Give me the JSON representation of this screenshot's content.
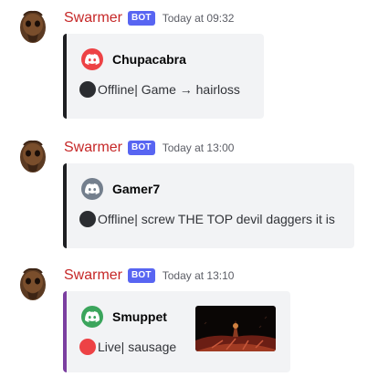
{
  "messages": [
    {
      "username": "Swarmer",
      "username_color": "#c62828",
      "bot_tag": "BOT",
      "timestamp": "Today at 09:32",
      "embed": {
        "author": "Chupacabra",
        "author_icon": "discord-logo-icon",
        "author_icon_color": "#ed4245",
        "status_icon": "offline-status-icon",
        "status_color": "#2b2d31",
        "description": "Offline| Game → hairloss",
        "accent_color": "#1e1f22"
      }
    },
    {
      "username": "Swarmer",
      "username_color": "#c62828",
      "bot_tag": "BOT",
      "timestamp": "Today at 13:00",
      "embed": {
        "author": "Gamer7",
        "author_icon": "discord-logo-icon",
        "author_icon_color": "#747f8d",
        "status_icon": "offline-status-icon",
        "status_color": "#2b2d31",
        "description": "Offline| screw THE TOP devil daggers it is",
        "accent_color": "#1e1f22"
      }
    },
    {
      "username": "Swarmer",
      "username_color": "#c62828",
      "bot_tag": "BOT",
      "timestamp": "Today at 13:10",
      "embed": {
        "author": "Smuppet",
        "author_icon": "discord-logo-icon",
        "author_icon_color": "#3ba55c",
        "status_icon": "live-status-icon",
        "status_color": "#ed4245",
        "description": "Live| sausage",
        "accent_color": "#7b3fa0",
        "thumbnail": "game-screenshot-thumbnail"
      }
    }
  ]
}
